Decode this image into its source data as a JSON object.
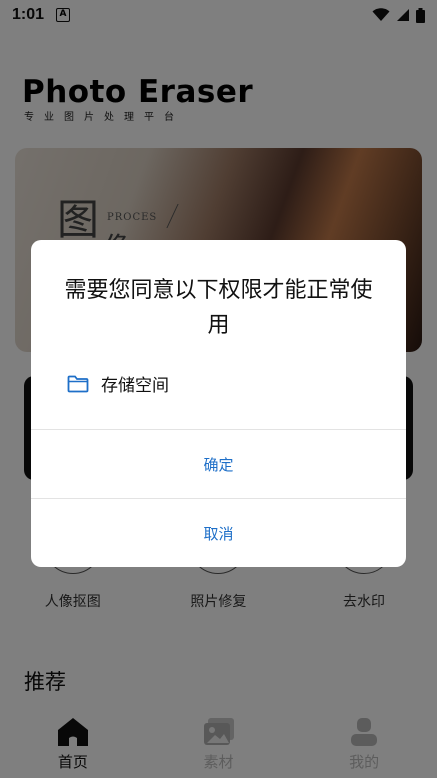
{
  "status_bar": {
    "time": "1:01",
    "notification_badge": "A"
  },
  "brand": {
    "title": "Photo Eraser",
    "subtitle": "专业图片处理平台"
  },
  "banner": {
    "char1": "图",
    "char2": "像",
    "process_text": "PROCES"
  },
  "tools": [
    {
      "label": "人像抠图"
    },
    {
      "label": "照片修复"
    },
    {
      "label": "去水印"
    }
  ],
  "section": {
    "title": "推荐"
  },
  "bottom_nav": [
    {
      "label": "首页",
      "icon": "home-icon",
      "active": true
    },
    {
      "label": "素材",
      "icon": "image-icon",
      "active": false
    },
    {
      "label": "我的",
      "icon": "user-icon",
      "active": false
    }
  ],
  "dialog": {
    "title": "需要您同意以下权限才能正常使用",
    "permission": {
      "label": "存储空间",
      "icon": "folder-icon"
    },
    "confirm_label": "确定",
    "cancel_label": "取消"
  },
  "colors": {
    "accent": "#1e6fc8",
    "scrim": "rgba(0,0,0,0.5)"
  }
}
